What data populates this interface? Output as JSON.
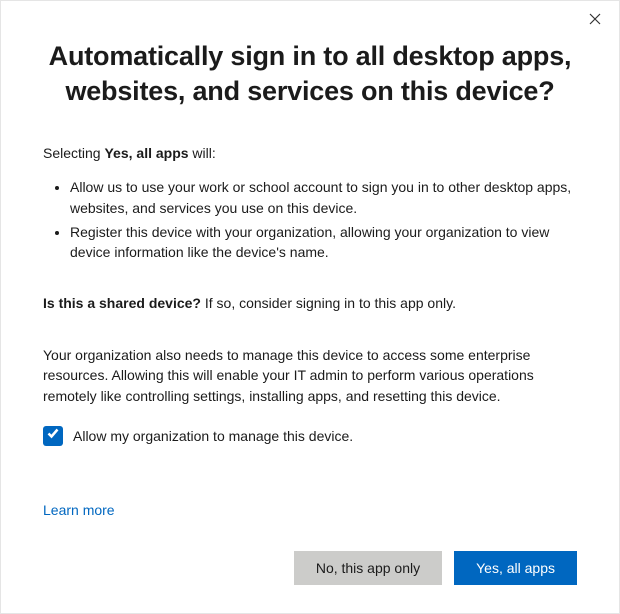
{
  "title": "Automatically sign in to all desktop apps, websites, and services on this device?",
  "intro": {
    "prefix": "Selecting ",
    "bold": "Yes, all apps",
    "suffix": " will:"
  },
  "bullets": [
    "Allow us to use your work or school account to sign you in to other desktop apps, websites, and services you use on this device.",
    "Register this device with your organization, allowing your organization to view device information like the device's name."
  ],
  "shared": {
    "bold": "Is this a shared device?",
    "rest": " If so, consider signing in to this app only."
  },
  "org_manage_text": "Your organization also needs to manage this device to access some enterprise resources. Allowing this will enable your IT admin to perform various operations remotely like controlling settings, installing apps, and resetting this device.",
  "checkbox": {
    "checked": true,
    "label": "Allow my organization to manage this device."
  },
  "learn_more": "Learn more",
  "buttons": {
    "secondary": "No, this app only",
    "primary": "Yes, all apps"
  }
}
